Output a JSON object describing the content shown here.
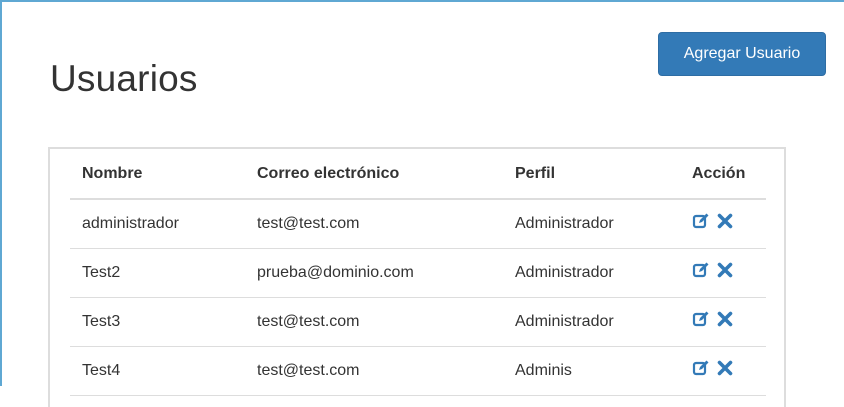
{
  "page": {
    "title": "Usuarios",
    "add_button_label": "Agregar Usuario"
  },
  "table": {
    "headers": {
      "name": "Nombre",
      "email": "Correo electrónico",
      "profile": "Perfil",
      "action": "Acción"
    },
    "rows": [
      {
        "name": "administrador",
        "email": "test@test.com",
        "profile": "Administrador",
        "actions": [
          "edit-icon",
          "delete-icon"
        ]
      },
      {
        "name": "Test2",
        "email": "prueba@dominio.com",
        "profile": "Administrador",
        "actions": [
          "edit-icon",
          "delete-icon"
        ]
      },
      {
        "name": "Test3",
        "email": "test@test.com",
        "profile": "Administrador",
        "actions": [
          "edit-icon",
          "delete-icon"
        ]
      },
      {
        "name": "Test4",
        "email": "test@test.com",
        "profile": "Adminis",
        "actions": [
          "edit-icon",
          "delete-icon"
        ]
      }
    ]
  },
  "colors": {
    "frame_border": "#5fa8d3",
    "primary": "#337ab7",
    "text": "#333333",
    "table_border": "#dddddd"
  }
}
